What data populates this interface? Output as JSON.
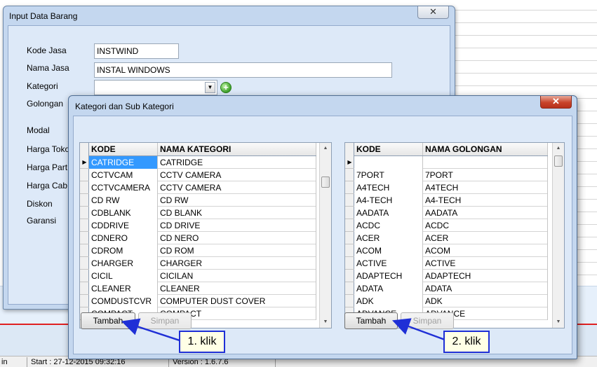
{
  "status_bar": {
    "start_label": "Start : 27-12-2015 09:32:16",
    "version_label": "Version : 1.6.7.6",
    "left_fragment": "in"
  },
  "input_window": {
    "title": "Input Data Barang",
    "close_glyph": "✕",
    "fields": {
      "kode_jasa": {
        "label": "Kode Jasa",
        "value": "INSTWIND"
      },
      "nama_jasa": {
        "label": "Nama Jasa",
        "value": "INSTAL WINDOWS"
      },
      "kategori": {
        "label": "Kategori",
        "value": ""
      },
      "golongan": {
        "label": "Golongan"
      },
      "modal": {
        "label": "Modal"
      },
      "harga_toko": {
        "label": "Harga Toko"
      },
      "harga_partai": {
        "label": "Harga Part"
      },
      "harga_cabang": {
        "label": "Harga Cab"
      },
      "diskon": {
        "label": "Diskon"
      },
      "garansi": {
        "label": "Garansi"
      }
    }
  },
  "category_window": {
    "title": "Kategori dan Sub Kategori",
    "close_glyph": "✕",
    "left_grid": {
      "columns": [
        "KODE",
        "NAMA KATEGORI"
      ],
      "rows": [
        [
          "CATRIDGE",
          "CATRIDGE"
        ],
        [
          "CCTVCAM",
          "CCTV CAMERA"
        ],
        [
          "CCTVCAMERA",
          "CCTV CAMERA"
        ],
        [
          "CD RW",
          "CD RW"
        ],
        [
          "CDBLANK",
          "CD BLANK"
        ],
        [
          "CDDRIVE",
          "CD DRIVE"
        ],
        [
          "CDNERO",
          "CD NERO"
        ],
        [
          "CDROM",
          "CD ROM"
        ],
        [
          "CHARGER",
          "CHARGER"
        ],
        [
          "CICIL",
          "CICILAN"
        ],
        [
          "CLEANER",
          "CLEANER"
        ],
        [
          "COMDUSTCVR",
          "COMPUTER DUST COVER"
        ],
        [
          "COMPACT",
          "COMPACT"
        ]
      ],
      "selected_index": 0,
      "buttons": {
        "add": "Tambah",
        "save": "Simpan"
      }
    },
    "right_grid": {
      "columns": [
        "KODE",
        "NAMA GOLONGAN"
      ],
      "rows": [
        [
          "",
          ""
        ],
        [
          "7PORT",
          "7PORT"
        ],
        [
          "A4TECH",
          "A4TECH"
        ],
        [
          "A4-TECH",
          "A4-TECH"
        ],
        [
          "AADATA",
          "AADATA"
        ],
        [
          "ACDC",
          "ACDC"
        ],
        [
          "ACER",
          "ACER"
        ],
        [
          "ACOM",
          "ACOM"
        ],
        [
          "ACTIVE",
          "ACTIVE"
        ],
        [
          "ADAPTECH",
          "ADAPTECH"
        ],
        [
          "ADATA",
          "ADATA"
        ],
        [
          "ADK",
          "ADK"
        ],
        [
          "ADVANCE",
          "ADVANCE"
        ]
      ],
      "buttons": {
        "add": "Tambah",
        "save": "Simpan"
      }
    }
  },
  "annotations": {
    "callout_1": "1. klik",
    "callout_2": "2. klik",
    "callout_color": "#1f2fd6"
  },
  "colors": {
    "window_frame": "#c4d7ef",
    "client_bg": "#dde9f8",
    "selection": "#3399ff",
    "close_red": "#c8432a"
  }
}
